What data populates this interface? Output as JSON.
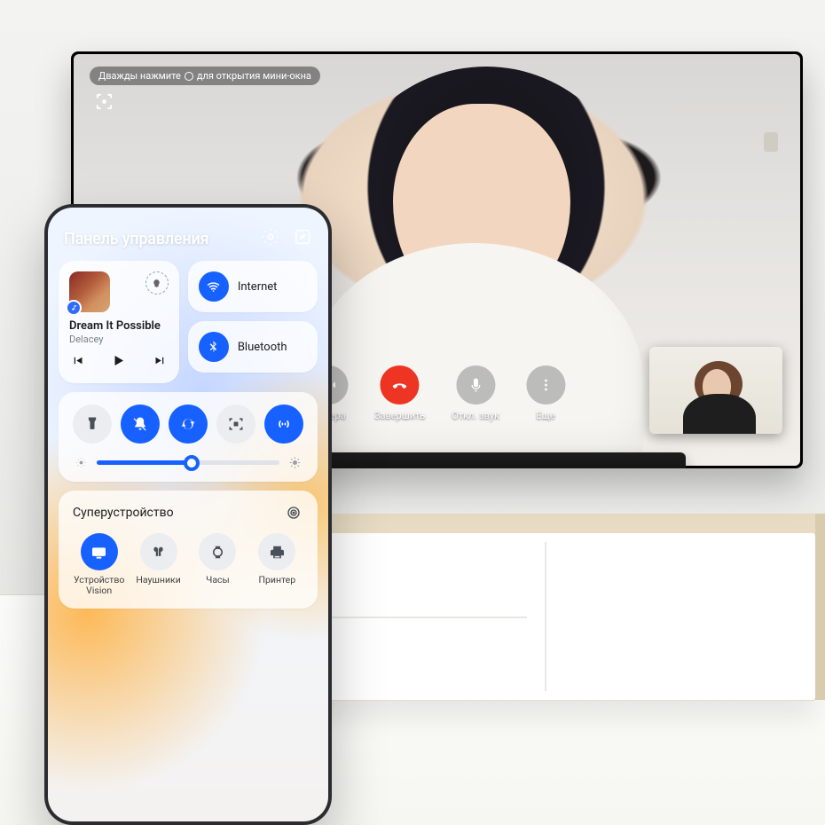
{
  "tv": {
    "tip_prefix": "Дважды нажмите",
    "tip_suffix": "для открытия мини-окна",
    "call": {
      "camera": "Камера",
      "end": "Завершить",
      "mute": "Откл. звук",
      "more": "Еще"
    }
  },
  "phone": {
    "title": "Панель управления",
    "music": {
      "title": "Dream It Possible",
      "artist": "Delacey"
    },
    "toggles": {
      "wifi": "Internet",
      "bluetooth": "Bluetooth"
    },
    "quick": {
      "labels": {
        "flashlight": "flashlight",
        "silent": "silent",
        "rotate": "auto-rotate",
        "screenshot": "screenshot",
        "nfc": "nfc"
      }
    },
    "brightness": 52,
    "super": {
      "title": "Суперустройство",
      "devices": {
        "vision": "Устройство\nVision",
        "earbuds": "Наушники",
        "watch": "Часы",
        "printer": "Принтер"
      }
    }
  }
}
